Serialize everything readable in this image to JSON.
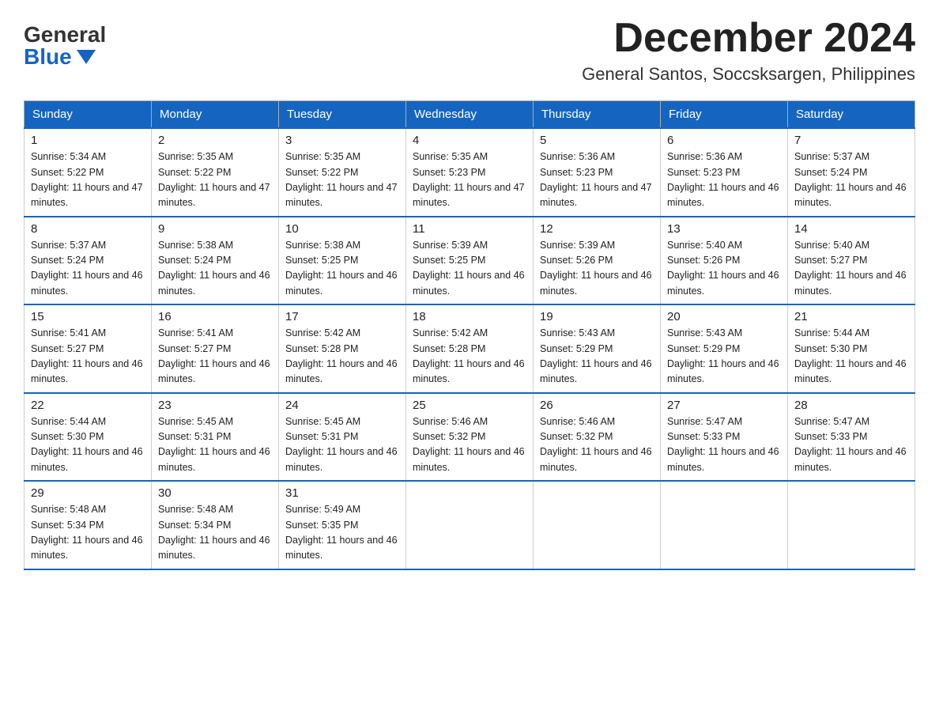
{
  "header": {
    "logo_general": "General",
    "logo_blue": "Blue",
    "month_title": "December 2024",
    "location": "General Santos, Soccsksargen, Philippines"
  },
  "weekdays": [
    "Sunday",
    "Monday",
    "Tuesday",
    "Wednesday",
    "Thursday",
    "Friday",
    "Saturday"
  ],
  "weeks": [
    [
      {
        "day": "1",
        "sunrise": "5:34 AM",
        "sunset": "5:22 PM",
        "daylight": "11 hours and 47 minutes."
      },
      {
        "day": "2",
        "sunrise": "5:35 AM",
        "sunset": "5:22 PM",
        "daylight": "11 hours and 47 minutes."
      },
      {
        "day": "3",
        "sunrise": "5:35 AM",
        "sunset": "5:22 PM",
        "daylight": "11 hours and 47 minutes."
      },
      {
        "day": "4",
        "sunrise": "5:35 AM",
        "sunset": "5:23 PM",
        "daylight": "11 hours and 47 minutes."
      },
      {
        "day": "5",
        "sunrise": "5:36 AM",
        "sunset": "5:23 PM",
        "daylight": "11 hours and 47 minutes."
      },
      {
        "day": "6",
        "sunrise": "5:36 AM",
        "sunset": "5:23 PM",
        "daylight": "11 hours and 46 minutes."
      },
      {
        "day": "7",
        "sunrise": "5:37 AM",
        "sunset": "5:24 PM",
        "daylight": "11 hours and 46 minutes."
      }
    ],
    [
      {
        "day": "8",
        "sunrise": "5:37 AM",
        "sunset": "5:24 PM",
        "daylight": "11 hours and 46 minutes."
      },
      {
        "day": "9",
        "sunrise": "5:38 AM",
        "sunset": "5:24 PM",
        "daylight": "11 hours and 46 minutes."
      },
      {
        "day": "10",
        "sunrise": "5:38 AM",
        "sunset": "5:25 PM",
        "daylight": "11 hours and 46 minutes."
      },
      {
        "day": "11",
        "sunrise": "5:39 AM",
        "sunset": "5:25 PM",
        "daylight": "11 hours and 46 minutes."
      },
      {
        "day": "12",
        "sunrise": "5:39 AM",
        "sunset": "5:26 PM",
        "daylight": "11 hours and 46 minutes."
      },
      {
        "day": "13",
        "sunrise": "5:40 AM",
        "sunset": "5:26 PM",
        "daylight": "11 hours and 46 minutes."
      },
      {
        "day": "14",
        "sunrise": "5:40 AM",
        "sunset": "5:27 PM",
        "daylight": "11 hours and 46 minutes."
      }
    ],
    [
      {
        "day": "15",
        "sunrise": "5:41 AM",
        "sunset": "5:27 PM",
        "daylight": "11 hours and 46 minutes."
      },
      {
        "day": "16",
        "sunrise": "5:41 AM",
        "sunset": "5:27 PM",
        "daylight": "11 hours and 46 minutes."
      },
      {
        "day": "17",
        "sunrise": "5:42 AM",
        "sunset": "5:28 PM",
        "daylight": "11 hours and 46 minutes."
      },
      {
        "day": "18",
        "sunrise": "5:42 AM",
        "sunset": "5:28 PM",
        "daylight": "11 hours and 46 minutes."
      },
      {
        "day": "19",
        "sunrise": "5:43 AM",
        "sunset": "5:29 PM",
        "daylight": "11 hours and 46 minutes."
      },
      {
        "day": "20",
        "sunrise": "5:43 AM",
        "sunset": "5:29 PM",
        "daylight": "11 hours and 46 minutes."
      },
      {
        "day": "21",
        "sunrise": "5:44 AM",
        "sunset": "5:30 PM",
        "daylight": "11 hours and 46 minutes."
      }
    ],
    [
      {
        "day": "22",
        "sunrise": "5:44 AM",
        "sunset": "5:30 PM",
        "daylight": "11 hours and 46 minutes."
      },
      {
        "day": "23",
        "sunrise": "5:45 AM",
        "sunset": "5:31 PM",
        "daylight": "11 hours and 46 minutes."
      },
      {
        "day": "24",
        "sunrise": "5:45 AM",
        "sunset": "5:31 PM",
        "daylight": "11 hours and 46 minutes."
      },
      {
        "day": "25",
        "sunrise": "5:46 AM",
        "sunset": "5:32 PM",
        "daylight": "11 hours and 46 minutes."
      },
      {
        "day": "26",
        "sunrise": "5:46 AM",
        "sunset": "5:32 PM",
        "daylight": "11 hours and 46 minutes."
      },
      {
        "day": "27",
        "sunrise": "5:47 AM",
        "sunset": "5:33 PM",
        "daylight": "11 hours and 46 minutes."
      },
      {
        "day": "28",
        "sunrise": "5:47 AM",
        "sunset": "5:33 PM",
        "daylight": "11 hours and 46 minutes."
      }
    ],
    [
      {
        "day": "29",
        "sunrise": "5:48 AM",
        "sunset": "5:34 PM",
        "daylight": "11 hours and 46 minutes."
      },
      {
        "day": "30",
        "sunrise": "5:48 AM",
        "sunset": "5:34 PM",
        "daylight": "11 hours and 46 minutes."
      },
      {
        "day": "31",
        "sunrise": "5:49 AM",
        "sunset": "5:35 PM",
        "daylight": "11 hours and 46 minutes."
      },
      null,
      null,
      null,
      null
    ]
  ]
}
